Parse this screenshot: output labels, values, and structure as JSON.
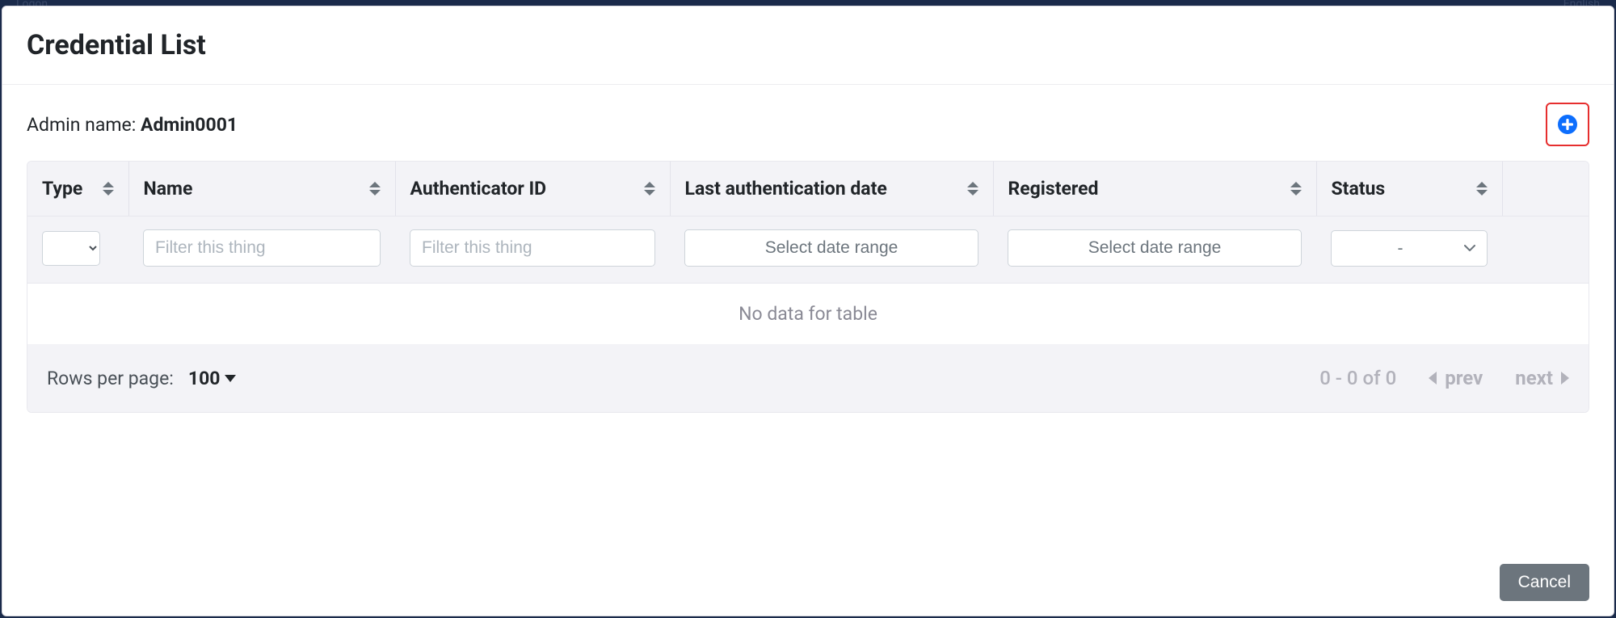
{
  "modal": {
    "title": "Credential List",
    "cancel_label": "Cancel"
  },
  "admin": {
    "label_prefix": "Admin name: ",
    "name": "Admin0001"
  },
  "add_button": {
    "semantic": "add-credential"
  },
  "columns": {
    "type": "Type",
    "name": "Name",
    "authenticator_id": "Authenticator ID",
    "last_auth_date": "Last authentication date",
    "registered": "Registered",
    "status": "Status"
  },
  "filters": {
    "name_placeholder": "Filter this thing",
    "auth_id_placeholder": "Filter this thing",
    "last_auth_date_placeholder": "Select date range",
    "registered_placeholder": "Select date range",
    "status_placeholder": "-"
  },
  "table": {
    "empty_message": "No data for table"
  },
  "pagination": {
    "rows_per_page_label": "Rows per page:",
    "rows_per_page_value": "100",
    "range_text": "0 - 0 of 0",
    "prev_label": "prev",
    "next_label": "next"
  },
  "background_hint": {
    "left": "Logon",
    "right": "English"
  }
}
